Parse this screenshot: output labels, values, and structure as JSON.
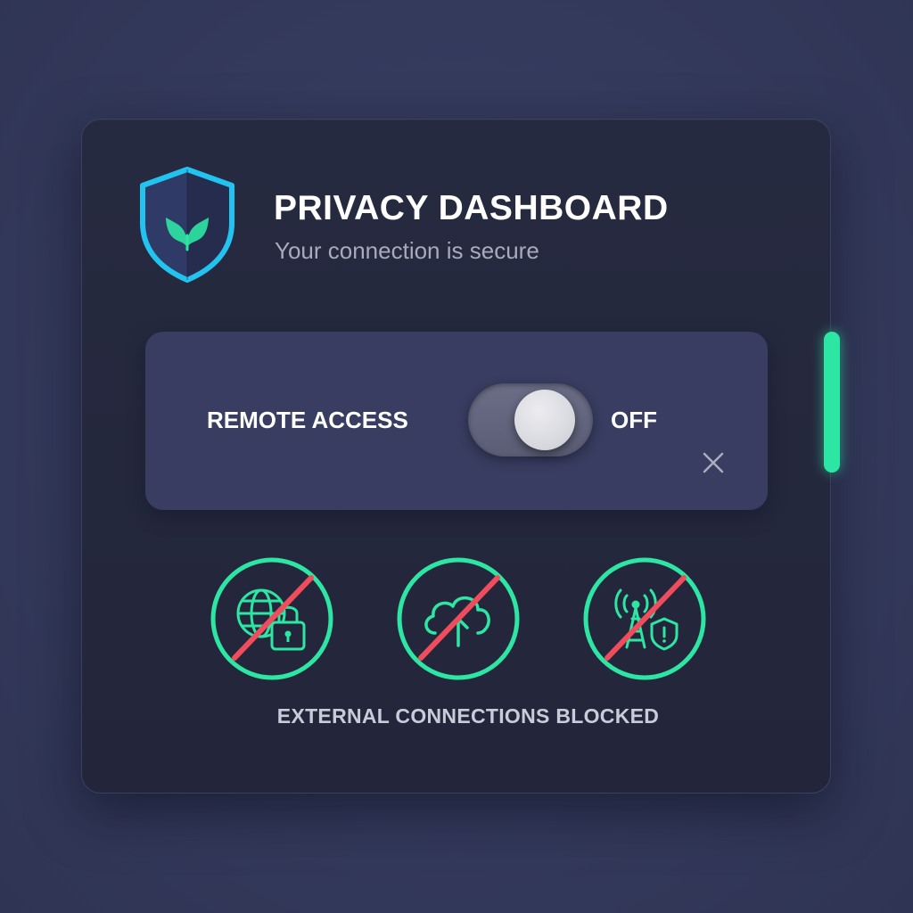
{
  "header": {
    "title": "PRIVACY DASHBOARD",
    "subtitle": "Your connection is secure",
    "logo_icon": "shield-leaf-icon"
  },
  "remote_access": {
    "label": "REMOTE ACCESS",
    "state_label": "OFF",
    "enabled": false,
    "close_icon": "close-icon"
  },
  "blocked_services": {
    "items": [
      {
        "icon": "globe-lock-blocked-icon",
        "name": "globe-lock"
      },
      {
        "icon": "cloud-upload-blocked-icon",
        "name": "cloud-upload"
      },
      {
        "icon": "signal-tower-blocked-icon",
        "name": "signal-tower"
      }
    ],
    "caption": "EXTERNAL CONNECTIONS BLOCKED"
  },
  "colors": {
    "background": "#343a5c",
    "panel": "#252940",
    "card": "#383d61",
    "accent_green": "#2ee6a3",
    "accent_cyan": "#22c3ee",
    "block_red": "#ef4d5c",
    "text_primary": "#ffffff",
    "text_secondary": "#a7abbc"
  }
}
